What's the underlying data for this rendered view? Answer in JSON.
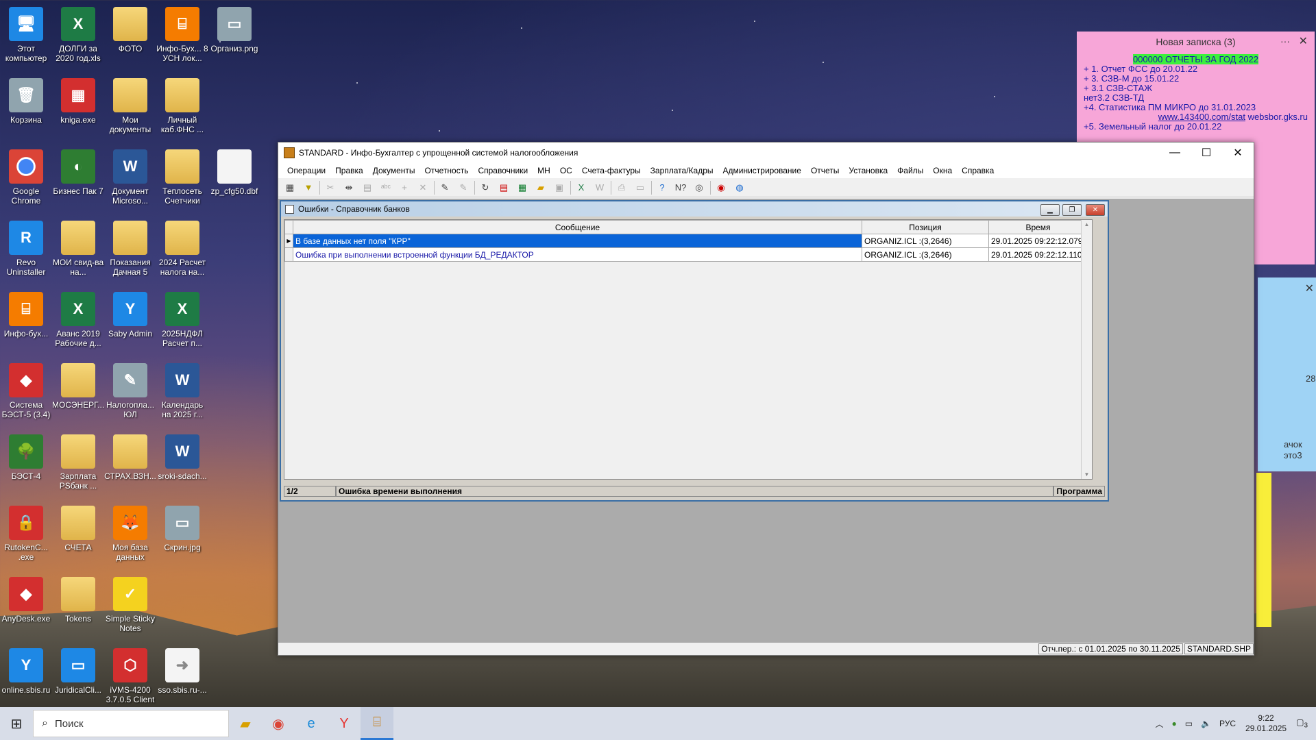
{
  "desktop": {
    "icons": [
      {
        "label": "Этот компьютер",
        "glyph": "🖥",
        "type": "blue"
      },
      {
        "label": "ДОЛГИ за 2020 год.xls",
        "glyph": "X",
        "type": "excel"
      },
      {
        "label": "ФОТО",
        "glyph": "",
        "type": "folder"
      },
      {
        "label": "Инфо-Бух... 8 УСН лок...",
        "glyph": "⌸",
        "type": "orange"
      },
      {
        "label": "Организ.png",
        "glyph": "▭",
        "type": "gray"
      },
      {
        "label": "Корзина",
        "glyph": "🗑",
        "type": "gray"
      },
      {
        "label": "kniga.exe",
        "glyph": "▦",
        "type": "red"
      },
      {
        "label": "Мои документы",
        "glyph": "",
        "type": "folder"
      },
      {
        "label": "Личный каб.ФНС ...",
        "glyph": "",
        "type": "folder"
      },
      {
        "label": "Google Chrome",
        "glyph": "",
        "type": "chrome"
      },
      {
        "label": "Бизнес Пак 7",
        "glyph": "◐",
        "type": "green"
      },
      {
        "label": "Документ Microso...",
        "glyph": "W",
        "type": "word"
      },
      {
        "label": "Теплосеть Счетчики",
        "glyph": "",
        "type": "folder"
      },
      {
        "label": "zp_cfg50.dbf",
        "glyph": "",
        "type": "file"
      },
      {
        "label": "Revo Uninstaller",
        "glyph": "R",
        "type": "blue"
      },
      {
        "label": "МОИ свид-ва на...",
        "glyph": "",
        "type": "folder"
      },
      {
        "label": "Показания Дачная 5",
        "glyph": "",
        "type": "folder"
      },
      {
        "label": "2024 Расчет налога на...",
        "glyph": "",
        "type": "folder"
      },
      {
        "label": "Инфо-бух...",
        "glyph": "⌸",
        "type": "orange"
      },
      {
        "label": "Аванс 2019 Рабочие д...",
        "glyph": "X",
        "type": "excel"
      },
      {
        "label": "Saby Admin",
        "glyph": "Y",
        "type": "blue"
      },
      {
        "label": "2025НДФЛ Расчет п...",
        "glyph": "X",
        "type": "excel"
      },
      {
        "label": "Система БЭСТ-5 (3.4)",
        "glyph": "◆",
        "type": "red"
      },
      {
        "label": "МОСЭНЕРГ...",
        "glyph": "",
        "type": "folder"
      },
      {
        "label": "Налогопла... ЮЛ",
        "glyph": "✎",
        "type": "gray"
      },
      {
        "label": "Календарь на 2025 г...",
        "glyph": "W",
        "type": "word"
      },
      {
        "label": "БЭСТ-4",
        "glyph": "🌳",
        "type": "green"
      },
      {
        "label": "Зарплата PSбанк ...",
        "glyph": "",
        "type": "folder"
      },
      {
        "label": "СТРАХ.ВЗН...",
        "glyph": "",
        "type": "folder"
      },
      {
        "label": "sroki-sdach...",
        "glyph": "W",
        "type": "word"
      },
      {
        "label": "RutokenC... .exe",
        "glyph": "🔒",
        "type": "red"
      },
      {
        "label": "СЧЕТА",
        "glyph": "",
        "type": "folder"
      },
      {
        "label": "Моя база данных",
        "glyph": "🦊",
        "type": "orange"
      },
      {
        "label": "Скрин.jpg",
        "glyph": "▭",
        "type": "gray"
      },
      {
        "label": "AnyDesk.exe",
        "glyph": "◆",
        "type": "red"
      },
      {
        "label": "Tokens",
        "glyph": "",
        "type": "folder"
      },
      {
        "label": "Simple Sticky Notes",
        "glyph": "✓",
        "type": "yellow"
      },
      {
        "label": "online.sbis.ru",
        "glyph": "Y",
        "type": "blue"
      },
      {
        "label": "JuridicalCli...",
        "glyph": "▭",
        "type": "blue"
      },
      {
        "label": "iVMS-4200 3.7.0.5 Client",
        "glyph": "⬡",
        "type": "red"
      },
      {
        "label": "sso.sbis.ru-...",
        "glyph": "➜",
        "type": "file"
      }
    ]
  },
  "sticky_pink": {
    "title": "Новая записка (3)",
    "dots": "···",
    "close": "✕",
    "lines": [
      "000000  ОТЧЕТЫ ЗА ГОД 2022",
      "+ 1. Отчет ФСС до 20.01.22",
      "+ 3. СЗВ-М до 15.01.22",
      "+ 3.1 СЗВ-СТАЖ",
      " нет3.2 СЗВ-ТД",
      "+4. Статистика ПМ МИКРО до 31.01.2023",
      "www.143400.com/stat",
      "websbor.gks.ru",
      " +5. Земельный налог до 20.01.22"
    ]
  },
  "sticky_blue": {
    "close": "✕",
    "text1": "28",
    "text2": "ачок",
    "text3": "это3"
  },
  "window": {
    "title": "STANDARD - Инфо-Бухгалтер с упрощенной системой налогообложения",
    "minimize": "—",
    "maximize": "☐",
    "close": "✕",
    "menu": [
      "Операции",
      "Правка",
      "Документы",
      "Отчетность",
      "Справочники",
      "МН",
      "ОС",
      "Счета-фактуры",
      "Зарплата/Кадры",
      "Администрирование",
      "Отчеты",
      "Установка",
      "Файлы",
      "Окна",
      "Справка"
    ],
    "status": {
      "period": "Отч.пер.: с 01.01.2025 по 30.11.2025",
      "file": "STANDARD.SHP"
    }
  },
  "child": {
    "title": "Ошибки - Справочник банков",
    "columns": [
      "Сообщение",
      "Позиция",
      "Время"
    ],
    "rows": [
      {
        "message": "В базе данных нет поля \"КРР\"",
        "position": "ORGANIZ.ICL :(3,2646)",
        "time": "29.01.2025 09:22:12.079"
      },
      {
        "message": "Ошибка при выполнении встроенной функции БД_РЕДАКТОР",
        "position": "ORGANIZ.ICL :(3,2646)",
        "time": "29.01.2025 09:22:12.110"
      }
    ],
    "status": {
      "count": "1/2",
      "type": "Ошибка времени выполнения",
      "source": "Программа"
    }
  },
  "taskbar": {
    "search_placeholder": "Поиск",
    "lang": "РУС",
    "time": "9:22",
    "date": "29.01.2025",
    "notifications": "3"
  }
}
